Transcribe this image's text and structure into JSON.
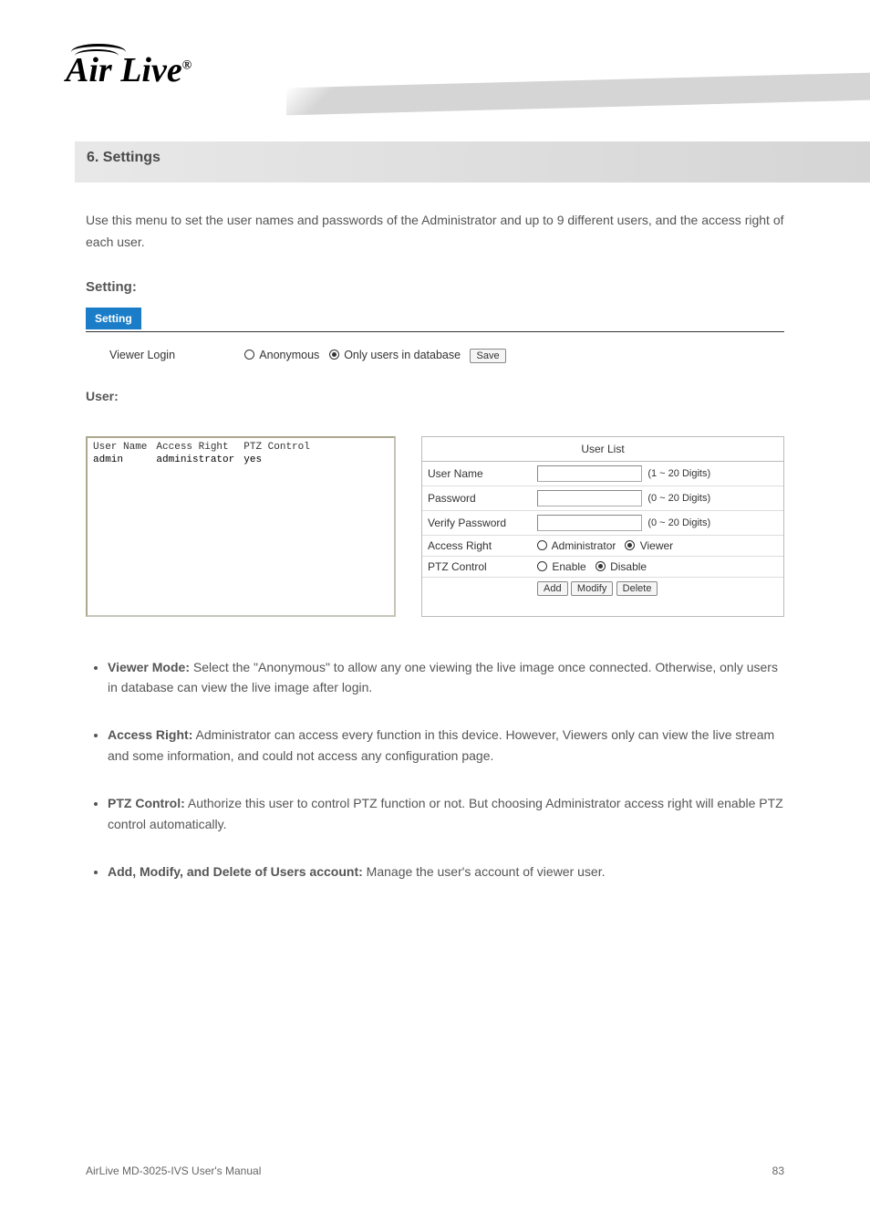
{
  "section_title": "6. Settings",
  "intro": "Use this menu to set the user names and passwords of the Administrator and up to 9 different users, and the access right of each user.",
  "setting_subhead": "Setting:",
  "setting_button": "Setting",
  "viewer_login_label": "Viewer Login",
  "radio_anonymous": "Anonymous",
  "radio_onlyusers": "Only users in database",
  "save_btn": "Save",
  "user_subhead": "User:",
  "user_table": {
    "headers": [
      "User Name",
      "Access Right",
      "PTZ Control"
    ],
    "rows": [
      [
        "admin",
        "administrator",
        "yes"
      ]
    ]
  },
  "user_list": {
    "title": "User List",
    "fields": {
      "username_label": "User Name",
      "username_hint": "(1 ~ 20 Digits)",
      "password_label": "Password",
      "password_hint": "(0 ~ 20 Digits)",
      "verify_label": "Verify Password",
      "verify_hint": "(0 ~ 20 Digits)",
      "access_label": "Access Right",
      "access_admin": "Administrator",
      "access_viewer": "Viewer",
      "ptz_label": "PTZ Control",
      "ptz_enable": "Enable",
      "ptz_disable": "Disable",
      "btn_add": "Add",
      "btn_modify": "Modify",
      "btn_delete": "Delete"
    }
  },
  "bullets": [
    {
      "head": "Viewer Mode:",
      "body": " Select the \"Anonymous\" to allow any one viewing the live image once connected. Otherwise, only users in database can view the live image after login."
    },
    {
      "head": "Access Right:",
      "body": " Administrator can access every function in this device. However, Viewers only can view the live stream and some information, and could not access any configuration page."
    },
    {
      "head": "PTZ Control:",
      "body": " Authorize this user to control PTZ function or not. But choosing Administrator access right will enable PTZ control automatically."
    },
    {
      "head": "Add, Modify, and Delete of Users account:",
      "body": " Manage the user's account of viewer user."
    }
  ],
  "footer_left": "AirLive MD-3025-IVS User's Manual",
  "footer_right": "83"
}
